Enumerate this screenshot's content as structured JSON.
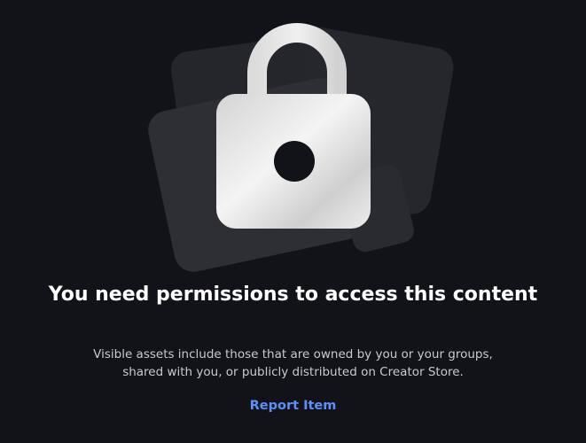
{
  "permission_notice": {
    "title": "You need permissions to access this content",
    "description": "Visible assets include those that are owned by you or your groups, shared with you, or publicly distributed on Creator Store.",
    "report_link_label": "Report Item",
    "illustration_icon": "lock-icon"
  },
  "colors": {
    "background": "#121318",
    "title_text": "#ffffff",
    "description_text": "#c9cacf",
    "link": "#5b8ff9",
    "card_back": "#26272c",
    "card_front": "#2e2f35",
    "lock_body": "#d9d9d9"
  }
}
